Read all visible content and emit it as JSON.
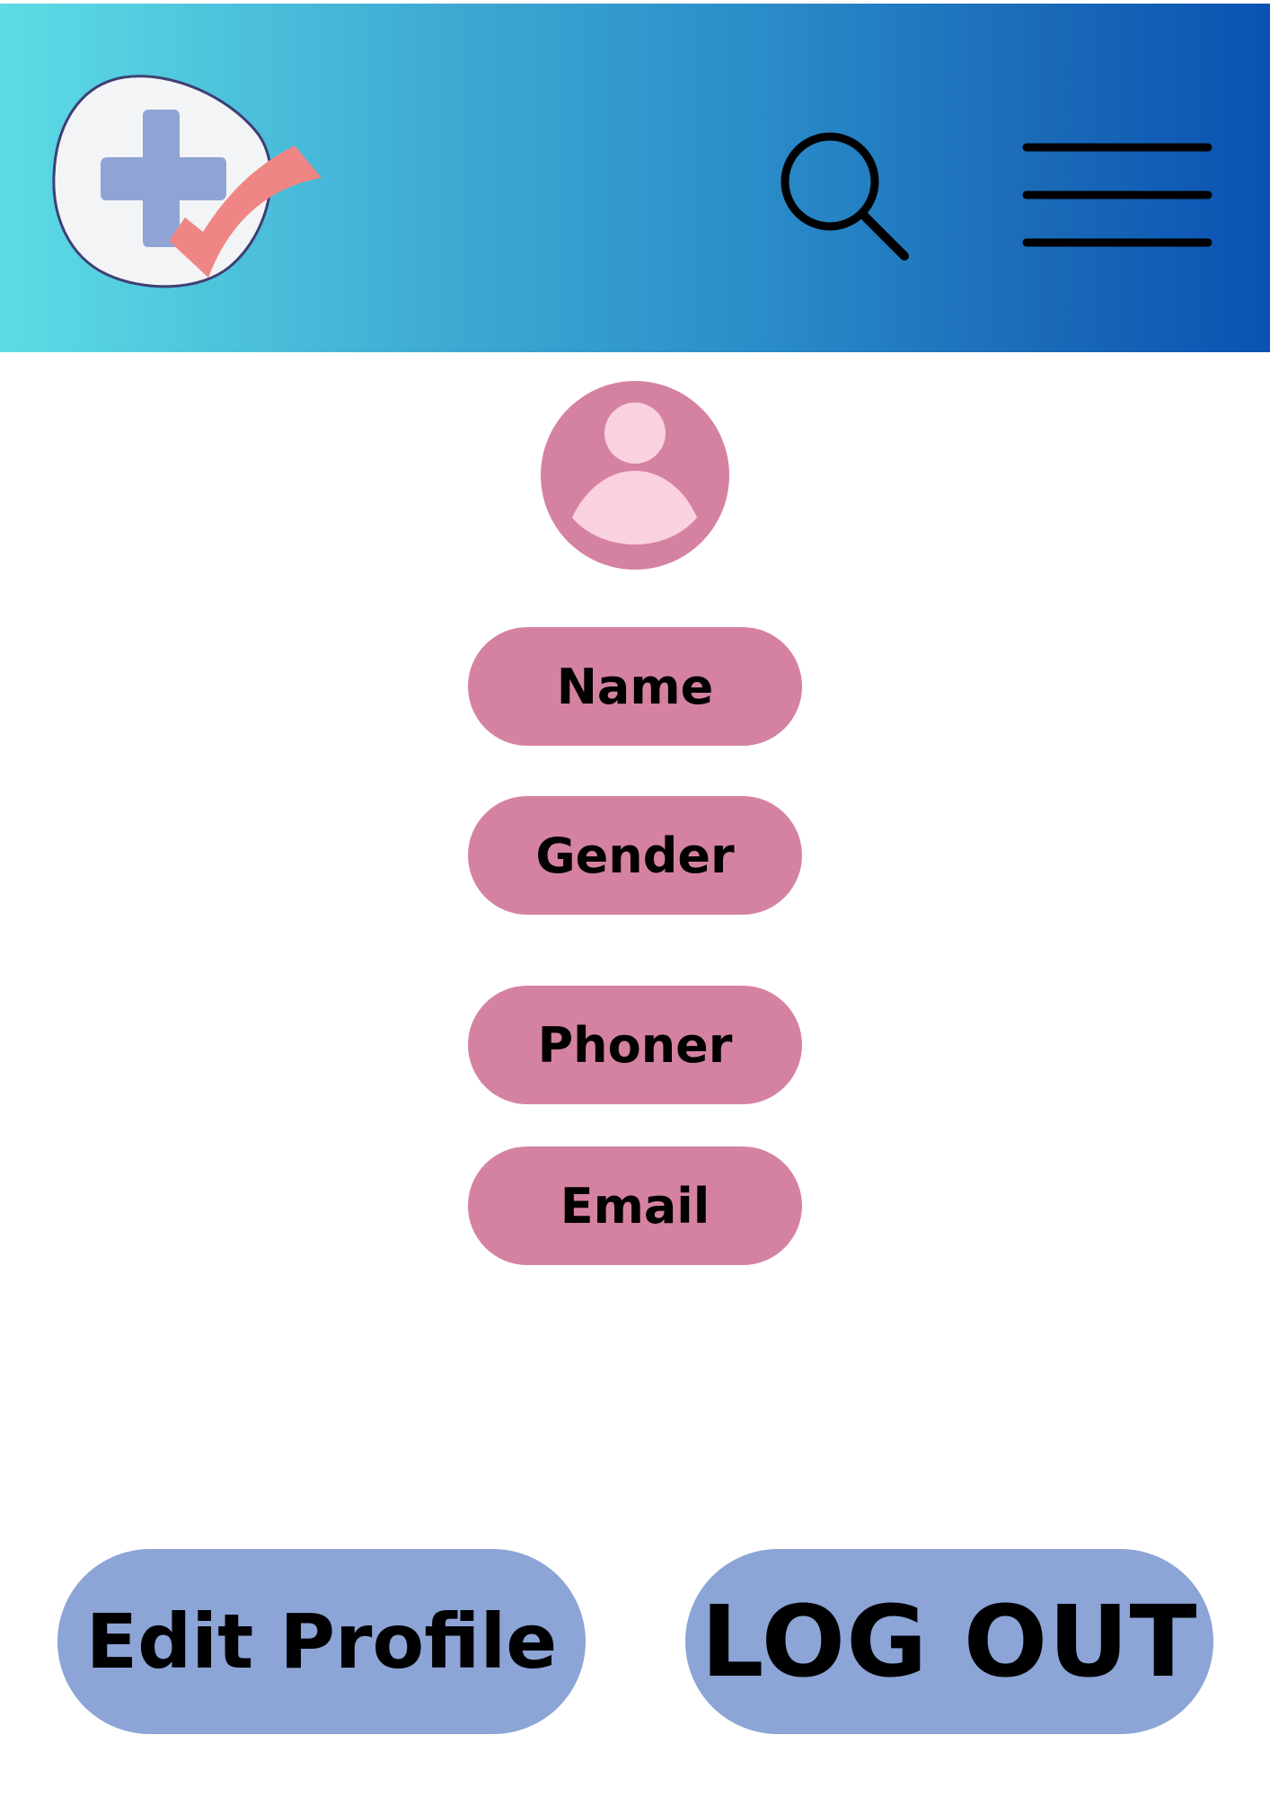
{
  "header": {
    "gradient_start": "#5ddce5",
    "gradient_end": "#0a52b3",
    "logo_icon": "medical-cross-check-logo",
    "search_icon": "search-icon",
    "menu_icon": "hamburger-menu-icon"
  },
  "profile": {
    "avatar_icon": "user-avatar-icon",
    "fields": {
      "name": "Name",
      "gender": "Gender",
      "phone": "Phoner",
      "email": "Email"
    },
    "field_color": "#d582a2"
  },
  "actions": {
    "edit_label": "Edit Profile",
    "logout_label": "LOG OUT",
    "button_color": "#8ca4d6"
  }
}
